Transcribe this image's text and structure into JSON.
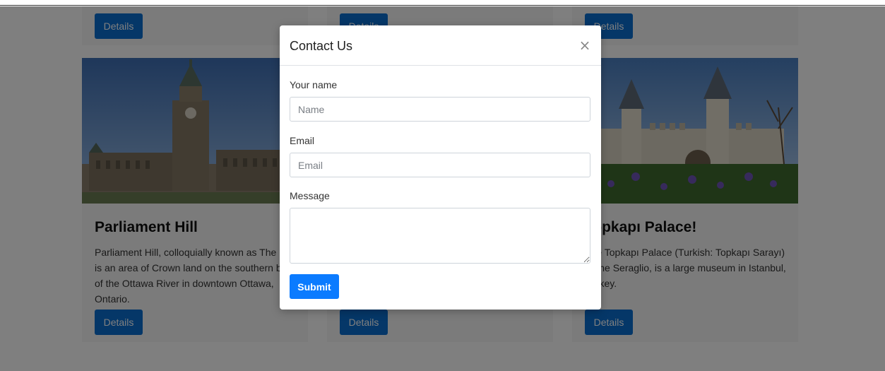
{
  "cards_top_row": [
    {
      "details_label": "Details"
    },
    {
      "details_label": "Details"
    },
    {
      "details_label": "Details"
    }
  ],
  "cards": [
    {
      "title": "Parliament Hill",
      "text": "Parliament Hill, colloquially known as The Hill, is an area of Crown land on the southern banks of the Ottawa River in downtown Ottawa, Ontario.",
      "details_label": "Details"
    },
    {
      "title": "",
      "text": "",
      "details_label": "Details"
    },
    {
      "title": "Topkapı Palace!",
      "text": "The Topkapı Palace (Turkish: Topkapı Sarayı) or the Seraglio, is a large museum in Istanbul, Turkey.",
      "details_label": "Details"
    }
  ],
  "modal": {
    "title": "Contact Us",
    "close_symbol": "×",
    "name_label": "Your name",
    "name_placeholder": "Name",
    "name_value": "",
    "email_label": "Email",
    "email_placeholder": "Email",
    "email_value": "",
    "message_label": "Message",
    "message_value": "",
    "submit_label": "Submit"
  },
  "colors": {
    "primary_button": "#0b7bff",
    "details_button": "#0a6ed1",
    "backdrop": "rgba(0,0,0,0.5)"
  },
  "icons": {
    "close": "close-icon"
  }
}
